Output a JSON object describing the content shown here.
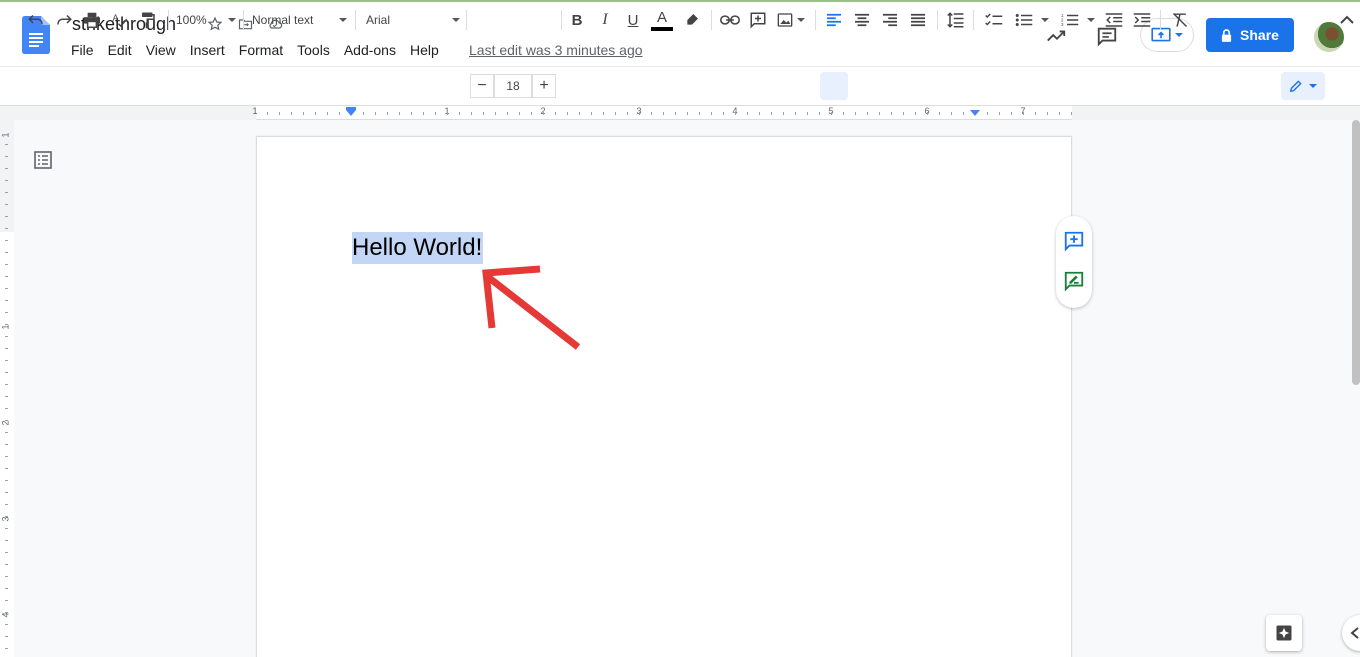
{
  "document": {
    "title": "strikethrough",
    "last_edit": "Last edit was 3 minutes ago",
    "body_text": "Hello World!"
  },
  "menu": [
    "File",
    "Edit",
    "View",
    "Insert",
    "Format",
    "Tools",
    "Add-ons",
    "Help"
  ],
  "header": {
    "share_label": "Share",
    "icons": [
      "star-icon",
      "move-to-folder-icon",
      "cloud-status-icon",
      "activity-icon",
      "comments-icon",
      "present-icon",
      "lock-icon"
    ]
  },
  "toolbar": {
    "zoom": "100%",
    "style": "Normal text",
    "font": "Arial",
    "font_size": "18",
    "minus": "−",
    "plus": "+",
    "bold": "B",
    "italic": "I",
    "underline": "U",
    "text_color": "A"
  },
  "ruler": {
    "horizontal_labels": [
      "1",
      "1",
      "2",
      "3",
      "4",
      "5",
      "6",
      "7"
    ],
    "vertical_labels": [
      "1",
      "1",
      "2",
      "3",
      "4"
    ]
  },
  "colors": {
    "accent": "#1a73e8",
    "selection": "#c3d6f5",
    "annotation_arrow": "#e53935",
    "suggest_green": "#188038"
  }
}
